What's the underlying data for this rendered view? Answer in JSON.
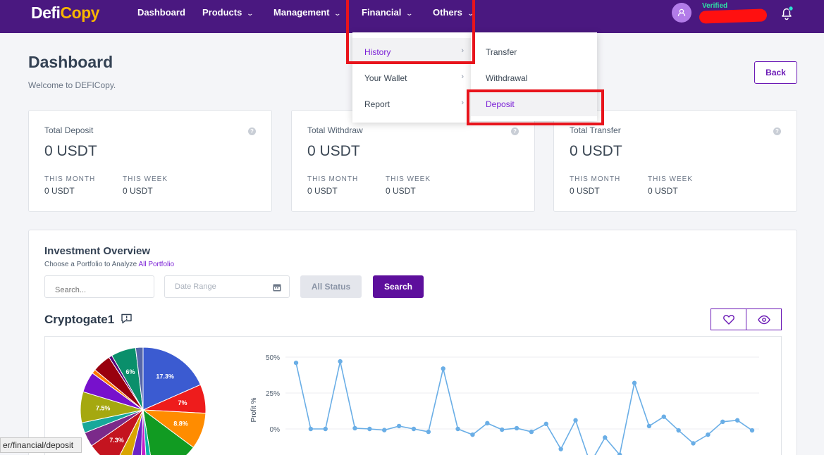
{
  "header": {
    "logo_part1": "Defi",
    "logo_part2": "Copy",
    "nav": [
      {
        "label": "Dashboard",
        "chevron": false
      },
      {
        "label": "Products",
        "chevron": true
      },
      {
        "label": "Management",
        "chevron": true
      },
      {
        "label": "Financial",
        "chevron": true
      },
      {
        "label": "Others",
        "chevron": true
      }
    ],
    "user_status": "Verified",
    "avatar_icon": "user-icon",
    "bell_icon": "bell-icon"
  },
  "financial_menu": {
    "items": [
      {
        "label": "History"
      },
      {
        "label": "Your Wallet"
      },
      {
        "label": "Report"
      }
    ],
    "history_submenu": [
      {
        "label": "Transfer"
      },
      {
        "label": "Withdrawal"
      },
      {
        "label": "Deposit"
      }
    ]
  },
  "page": {
    "title": "Dashboard",
    "welcome": "Welcome to DEFICopy.",
    "back_label": "Back"
  },
  "cards": [
    {
      "title": "Total Deposit",
      "amount": "0 USDT",
      "month_label": "THIS MONTH",
      "month_value": "0 USDT",
      "week_label": "THIS WEEK",
      "week_value": "0 USDT"
    },
    {
      "title": "Total Withdraw",
      "amount": "0 USDT",
      "month_label": "THIS MONTH",
      "month_value": "0 USDT",
      "week_label": "THIS WEEK",
      "week_value": "0 USDT"
    },
    {
      "title": "Total Transfer",
      "amount": "0 USDT",
      "month_label": "THIS MONTH",
      "month_value": "0 USDT",
      "week_label": "THIS WEEK",
      "week_value": "0 USDT"
    }
  ],
  "investment": {
    "title": "Investment Overview",
    "subtitle": "Choose a Portfolio to Analyze",
    "subtitle_link": "All Portfolio",
    "search_placeholder": "Search...",
    "date_placeholder": "Date Range",
    "status_label": "All Status",
    "search_button": "Search",
    "portfolio_name": "Cryptogate1"
  },
  "chart_data": [
    {
      "type": "pie",
      "slices": [
        {
          "label": "17.3%",
          "value": 17.3,
          "color": "#3b5bd1"
        },
        {
          "label": "7%",
          "value": 7,
          "color": "#ee1c1c"
        },
        {
          "label": "8.8%",
          "value": 8.8,
          "color": "#ff8c00"
        },
        {
          "label": "",
          "value": 11.5,
          "color": "#119b22"
        },
        {
          "label": "",
          "value": 1.5,
          "color": "#0bb5a8"
        },
        {
          "label": "",
          "value": 1.5,
          "color": "#c21fc9"
        },
        {
          "label": "",
          "value": 3,
          "color": "#6b23c5"
        },
        {
          "label": "",
          "value": 3.5,
          "color": "#d9a400"
        },
        {
          "label": "7.3%",
          "value": 7.3,
          "color": "#c4141f"
        },
        {
          "label": "",
          "value": 3.5,
          "color": "#7b2a8a"
        },
        {
          "label": "",
          "value": 2.5,
          "color": "#17a89a"
        },
        {
          "label": "7.5%",
          "value": 7.5,
          "color": "#a5a80f"
        },
        {
          "label": "",
          "value": 5,
          "color": "#7711cc"
        },
        {
          "label": "",
          "value": 1,
          "color": "#ff7a00"
        },
        {
          "label": "",
          "value": 4.5,
          "color": "#99000e"
        },
        {
          "label": "",
          "value": 0.8,
          "color": "#550077"
        },
        {
          "label": "6%",
          "value": 6,
          "color": "#0a8f6b"
        },
        {
          "label": "",
          "value": 1.8,
          "color": "#5566aa"
        }
      ]
    },
    {
      "type": "line",
      "ylabel": "Profit %",
      "yticks": [
        "50%",
        "25%",
        "0%"
      ],
      "ylim": [
        -15,
        50
      ],
      "color": "#6aaee6",
      "series": [
        {
          "values": [
            46,
            0,
            0,
            47,
            0.5,
            0,
            -0.8,
            2,
            0,
            -2,
            42,
            0,
            -4,
            4,
            -0.5,
            0.5,
            -2,
            3.5,
            -14,
            6,
            -24,
            -6,
            -18,
            32,
            2,
            8.5,
            -1,
            -10,
            -4,
            5,
            6,
            -1
          ]
        }
      ]
    }
  ],
  "status_bar": {
    "url": "er/financial/deposit"
  }
}
